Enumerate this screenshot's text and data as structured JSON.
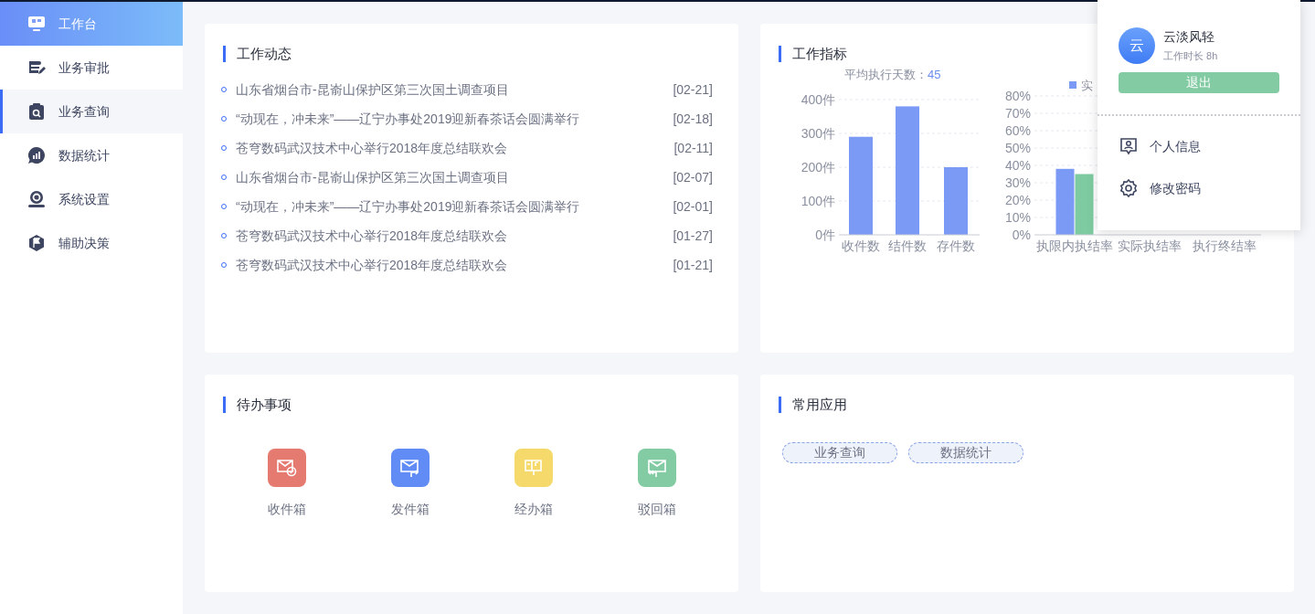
{
  "sidebar": {
    "items": [
      {
        "label": "工作台",
        "selected": true,
        "highlighted": false
      },
      {
        "label": "业务审批",
        "selected": false,
        "highlighted": false
      },
      {
        "label": "业务查询",
        "selected": false,
        "highlighted": true
      },
      {
        "label": "数据统计",
        "selected": false,
        "highlighted": false
      },
      {
        "label": "系统设置",
        "selected": false,
        "highlighted": false
      },
      {
        "label": "辅助决策",
        "selected": false,
        "highlighted": false
      }
    ]
  },
  "work_news": {
    "title": "工作动态",
    "items": [
      {
        "text": "山东省烟台市-昆嵛山保护区第三次国土调查项目",
        "date": "[02-21]"
      },
      {
        "text": "“动现在，冲未来”——辽宁办事处2019迎新春茶话会圆满举行",
        "date": "[02-18]"
      },
      {
        "text": "苍穹数码武汉技术中心举行2018年度总结联欢会",
        "date": "[02-11]"
      },
      {
        "text": "山东省烟台市-昆嵛山保护区第三次国土调查项目",
        "date": "[02-07]"
      },
      {
        "text": "“动现在，冲未来”——辽宁办事处2019迎新春茶话会圆满举行",
        "date": "[02-01]"
      },
      {
        "text": "苍穹数码武汉技术中心举行2018年度总结联欢会",
        "date": "[01-27]"
      },
      {
        "text": "苍穹数码武汉技术中心举行2018年度总结联欢会",
        "date": "[01-21]"
      }
    ]
  },
  "work_metrics": {
    "title": "工作指标",
    "summary": {
      "label": "平均执行天数：",
      "value": "45"
    },
    "charts": [
      {
        "chart_data": {
          "type": "bar",
          "categories": [
            "收件数",
            "结件数",
            "存件数"
          ],
          "series": [
            {
              "color": "#7b9af5",
              "values": [
                290,
                380,
                200
              ]
            }
          ],
          "grid": true,
          "ylim": [
            0,
            400
          ],
          "yticks": [
            {
              "value": 0,
              "label": "0件"
            },
            {
              "value": 100,
              "label": "100件"
            },
            {
              "value": 200,
              "label": "200件"
            },
            {
              "value": 300,
              "label": "300件"
            },
            {
              "value": 400,
              "label": "400件"
            }
          ]
        }
      },
      {
        "chart_data": {
          "type": "bar",
          "categories": [
            "执限内执结率",
            "实际执结率",
            "执行终结率"
          ],
          "series": [
            {
              "name": "实",
              "color": "#7b9af5",
              "values": [
                38,
                null,
                null
              ]
            },
            {
              "color": "#7ecba1",
              "values": [
                35,
                null,
                null
              ]
            }
          ],
          "grid": true,
          "ylim": [
            0,
            80
          ],
          "yticks": [
            {
              "value": 0,
              "label": "0%"
            },
            {
              "value": 10,
              "label": "10%"
            },
            {
              "value": 20,
              "label": "20%"
            },
            {
              "value": 30,
              "label": "30%"
            },
            {
              "value": 40,
              "label": "40%"
            },
            {
              "value": 50,
              "label": "50%"
            },
            {
              "value": 60,
              "label": "60%"
            },
            {
              "value": 70,
              "label": "70%"
            },
            {
              "value": 80,
              "label": "80%"
            }
          ]
        }
      }
    ]
  },
  "todo": {
    "title": "待办事项",
    "items": [
      {
        "label": "收件箱",
        "color": "#e57a70"
      },
      {
        "label": "发件箱",
        "color": "#628cf5"
      },
      {
        "label": "经办箱",
        "color": "#f5d96b"
      },
      {
        "label": "驳回箱",
        "color": "#82cba3"
      }
    ]
  },
  "apps": {
    "title": "常用应用",
    "tags": [
      "业务查询",
      "数据统计"
    ]
  },
  "user_menu": {
    "avatar": "云",
    "name": "云淡风轻",
    "subtitle": "工作时长 8h",
    "logout": "退出",
    "items": [
      {
        "label": "个人信息"
      },
      {
        "label": "修改密码"
      }
    ]
  }
}
